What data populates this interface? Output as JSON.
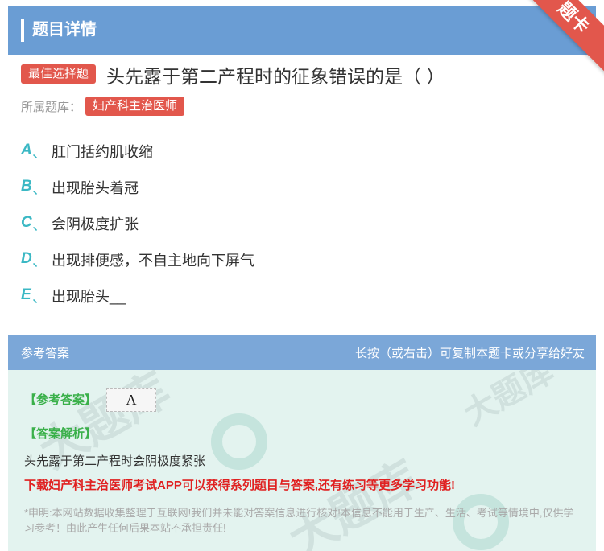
{
  "header": {
    "title": "题目详情"
  },
  "corner": {
    "label": "题卡"
  },
  "question": {
    "type_tag": "最佳选择题",
    "text": "头先露于第二产程时的征象错误的是（  ）"
  },
  "bank": {
    "label": "所属题库：",
    "name": "妇产科主治医师"
  },
  "options": [
    {
      "letter": "A",
      "sep": "、",
      "text": "肛门括约肌收缩"
    },
    {
      "letter": "B",
      "sep": "、",
      "text": "出现胎头着冠"
    },
    {
      "letter": "C",
      "sep": "、",
      "text": "会阴极度扩张"
    },
    {
      "letter": "D",
      "sep": "、",
      "text": "出现排便感，不自主地向下屏气"
    },
    {
      "letter": "E",
      "sep": "、",
      "text": "出现胎头__"
    }
  ],
  "answer": {
    "header_left": "参考答案",
    "header_right": "长按（或右击）可复制本题卡或分享给好友",
    "answer_label": "【参考答案】",
    "answer_value": "A",
    "explanation_label": "【答案解析】",
    "explanation_text": "头先露于第二产程时会阴极度紧张",
    "promo": "下载妇产科主治医师考试APP可以获得系列题目与答案,还有练习等更多学习功能!",
    "disclaimer": "*申明:本网站数据收集整理于互联网!我们并未能对答案信息进行核对!本信息不能用于生产、生活、考试等情境中,仅供学习参考！由此产生任何后果本站不承担责任!"
  },
  "watermark": {
    "text": "大题库"
  },
  "colors": {
    "header_bg": "#6a9dd4",
    "tag_red": "#e2574c",
    "option_letter": "#3bb8c4",
    "answer_green": "#3ab04a",
    "promo_red": "#e02020",
    "panel_bg": "#e3f3ef"
  }
}
